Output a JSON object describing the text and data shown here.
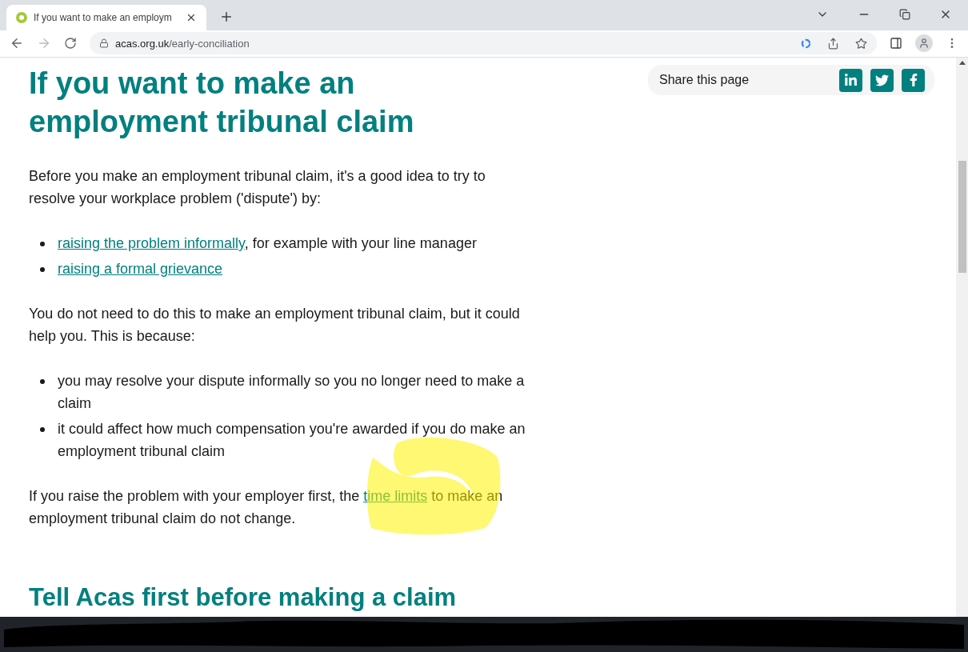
{
  "browser": {
    "tab": {
      "title": "If you want to make an employm",
      "selected": true
    },
    "address": {
      "domain": "acas.org.uk",
      "path": "/early-conciliation"
    }
  },
  "share": {
    "label": "Share this page"
  },
  "article": {
    "heading": "If you want to make an employment tribunal claim",
    "blocks": [
      {
        "kind": "paragraph",
        "parts": [
          {
            "text": "Before you make an employment tribunal claim, it's a good idea to try to resolve your workplace problem ('dispute') by:",
            "link": false
          }
        ]
      },
      {
        "kind": "list",
        "items": [
          [
            {
              "text": "raising the problem informally",
              "link": true
            },
            {
              "text": ", for example with your line manager",
              "link": false
            }
          ],
          [
            {
              "text": "raising a formal grievance",
              "link": true
            }
          ]
        ]
      },
      {
        "kind": "paragraph",
        "parts": [
          {
            "text": "You do not need to do this to make an employment tribunal claim, but it could help you. This is because:",
            "link": false
          }
        ]
      },
      {
        "kind": "list",
        "items": [
          [
            {
              "text": "you may resolve your dispute informally so you no longer need to make a claim",
              "link": false
            }
          ],
          [
            {
              "text": "it could affect how much compensation you're awarded if you do make an employment tribunal claim",
              "link": false
            }
          ]
        ]
      },
      {
        "kind": "paragraph",
        "parts": [
          {
            "text": "If you raise the problem with your employer first, the ",
            "link": false
          },
          {
            "text": "time limits",
            "link": true
          },
          {
            "text": " to make an employment tribunal claim do not change.",
            "link": false
          }
        ]
      }
    ],
    "subheading": "Tell Acas first before making a claim"
  }
}
